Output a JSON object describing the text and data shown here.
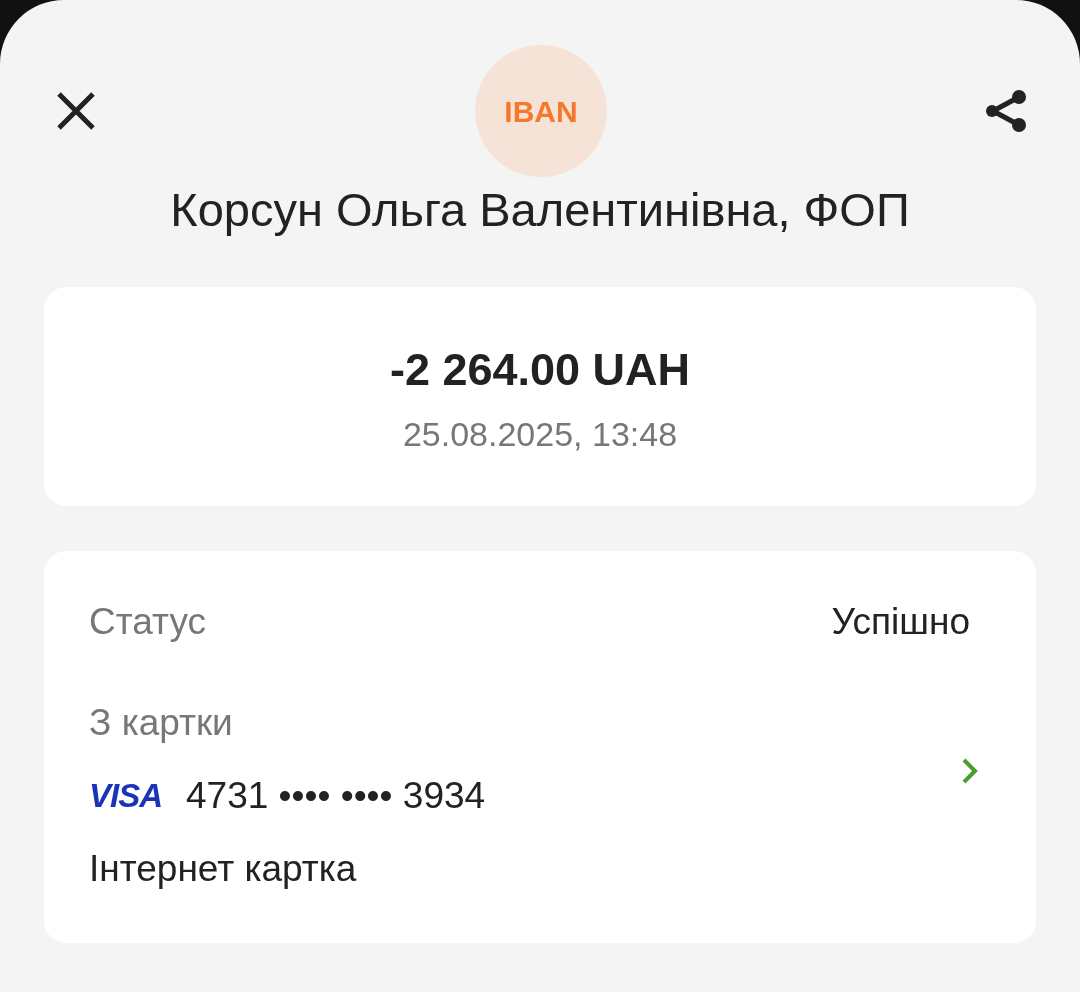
{
  "header": {
    "badge": "IBAN",
    "title": "Корсун Ольга Валентинівна, ФОП"
  },
  "amount_card": {
    "amount": "-2 264.00 UAH",
    "datetime": "25.08.2025, 13:48"
  },
  "details": {
    "status_label": "Статус",
    "status_value": "Успішно",
    "source_label": "З картки",
    "card_brand": "VISA",
    "card_number": "4731 •••• •••• 3934",
    "card_name": "Інтернет картка"
  }
}
